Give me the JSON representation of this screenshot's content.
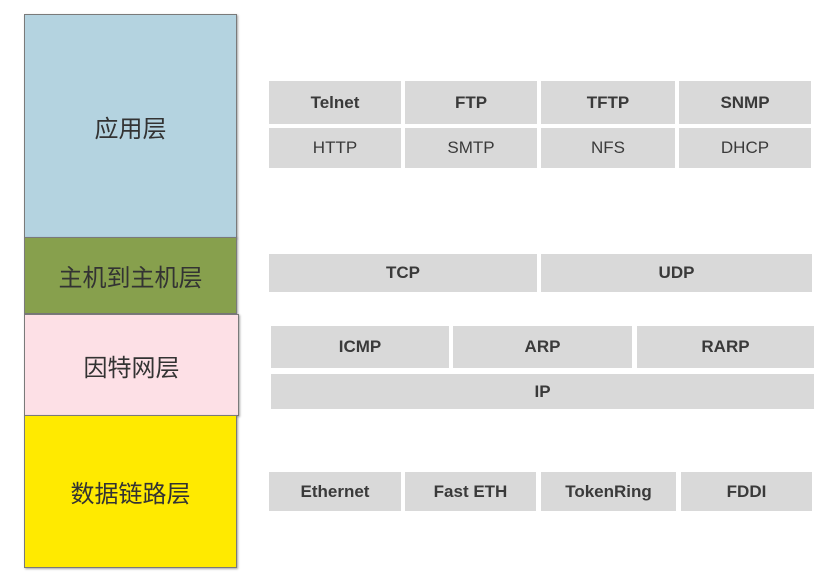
{
  "layers": [
    {
      "name": "应用层",
      "color": "#b4d3e0"
    },
    {
      "name": "主机到主机层",
      "color": "#87a04d"
    },
    {
      "name": "因特网层",
      "color": "#fde0e6"
    },
    {
      "name": "数据链路层",
      "color": "#ffea00"
    }
  ],
  "protocols": {
    "application": {
      "row1": [
        "Telnet",
        "FTP",
        "TFTP",
        "SNMP"
      ],
      "row2": [
        "HTTP",
        "SMTP",
        "NFS",
        "DHCP"
      ]
    },
    "transport": [
      "TCP",
      "UDP"
    ],
    "internet": {
      "row1": [
        "ICMP",
        "ARP",
        "RARP"
      ],
      "row2": [
        "IP"
      ]
    },
    "datalink": [
      "Ethernet",
      "Fast ETH",
      "TokenRing",
      "FDDI"
    ]
  },
  "colors": {
    "cell_background": "#d9d9d9",
    "cell_text": "#3a3a3a"
  }
}
